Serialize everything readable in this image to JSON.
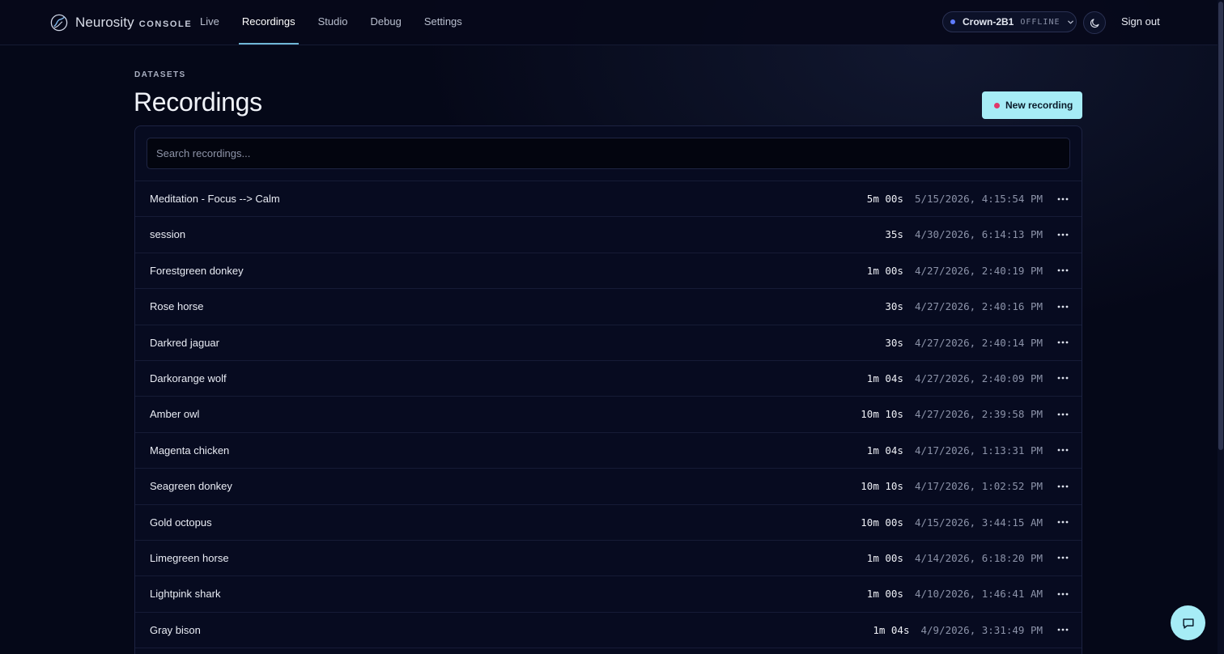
{
  "brand": {
    "name": "Neurosity",
    "suffix": "CONSOLE"
  },
  "nav": {
    "items": [
      {
        "label": "Live",
        "active": false
      },
      {
        "label": "Recordings",
        "active": true
      },
      {
        "label": "Studio",
        "active": false
      },
      {
        "label": "Debug",
        "active": false
      },
      {
        "label": "Settings",
        "active": false
      }
    ]
  },
  "device": {
    "name": "Crown-2B1",
    "status": "OFFLINE",
    "status_color": "#5f7cff"
  },
  "header": {
    "sign_out": "Sign out",
    "theme_icon": "moon-icon"
  },
  "page": {
    "eyebrow": "DATASETS",
    "title": "Recordings",
    "new_recording_label": "New recording"
  },
  "search": {
    "placeholder": "Search recordings...",
    "value": ""
  },
  "recordings": [
    {
      "name": "Meditation - Focus --> Calm",
      "duration": "5m 00s",
      "date": "5/15/2026, 4:15:54 PM"
    },
    {
      "name": "session",
      "duration": "35s",
      "date": "4/30/2026, 6:14:13 PM"
    },
    {
      "name": "Forestgreen donkey",
      "duration": "1m 00s",
      "date": "4/27/2026, 2:40:19 PM"
    },
    {
      "name": "Rose horse",
      "duration": "30s",
      "date": "4/27/2026, 2:40:16 PM"
    },
    {
      "name": "Darkred jaguar",
      "duration": "30s",
      "date": "4/27/2026, 2:40:14 PM"
    },
    {
      "name": "Darkorange wolf",
      "duration": "1m 04s",
      "date": "4/27/2026, 2:40:09 PM"
    },
    {
      "name": "Amber owl",
      "duration": "10m 10s",
      "date": "4/27/2026, 2:39:58 PM"
    },
    {
      "name": "Magenta chicken",
      "duration": "1m 04s",
      "date": "4/17/2026, 1:13:31 PM"
    },
    {
      "name": "Seagreen donkey",
      "duration": "10m 10s",
      "date": "4/17/2026, 1:02:52 PM"
    },
    {
      "name": "Gold octopus",
      "duration": "10m 00s",
      "date": "4/15/2026, 3:44:15 AM"
    },
    {
      "name": "Limegreen horse",
      "duration": "1m 00s",
      "date": "4/14/2026, 6:18:20 PM"
    },
    {
      "name": "Lightpink shark",
      "duration": "1m 00s",
      "date": "4/10/2026, 1:46:41 AM"
    },
    {
      "name": "Gray bison",
      "duration": "1m 04s",
      "date": "4/9/2026, 3:31:49 PM"
    },
    {
      "name": "",
      "duration": "",
      "date": ""
    }
  ],
  "colors": {
    "accent": "#a6ecf6",
    "record_dot": "#e0386a",
    "background": "#050818"
  },
  "icons": {
    "row_menu": "more-horizontal-icon",
    "chat": "chat-bubble-icon",
    "logo": "neurosity-logo"
  }
}
